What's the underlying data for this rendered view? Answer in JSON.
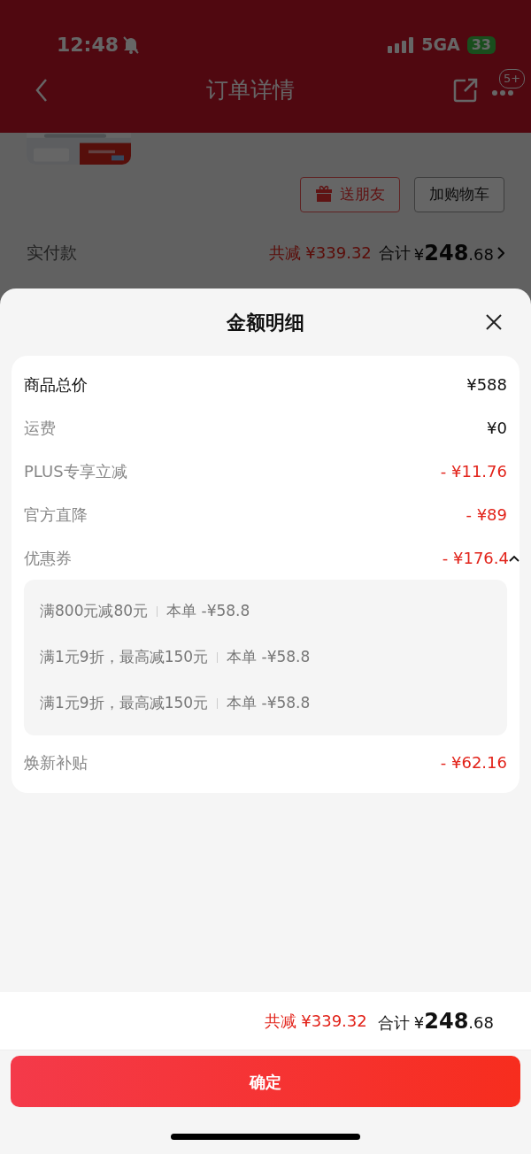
{
  "status_bar": {
    "time": "12:48",
    "network": "5GA",
    "battery": "33"
  },
  "background_page": {
    "title": "订单详情",
    "more_badge": "5+",
    "actions": [
      {
        "label": "送朋友",
        "kind": "gift"
      },
      {
        "label": "加购物车",
        "kind": "plain"
      }
    ],
    "paid": {
      "label": "实付款",
      "saved": "共减 ¥339.32",
      "total_label": "合计",
      "currency": "¥",
      "total_int": "248",
      "total_dec": ".68"
    }
  },
  "sheet": {
    "title": "金额明细",
    "rows": [
      {
        "label": "商品总价",
        "amount": "¥588",
        "kind": "total"
      },
      {
        "label": "运费",
        "amount": "¥0",
        "kind": "plain"
      },
      {
        "label": "PLUS专享立减",
        "amount": "- ¥11.76",
        "kind": "discount"
      },
      {
        "label": "官方直降",
        "amount": "- ¥89",
        "kind": "discount"
      },
      {
        "label": "优惠券",
        "amount": "- ¥176.4",
        "kind": "discount",
        "expanded": true,
        "children": [
          {
            "rule": "满800元减80元",
            "share": "本单 -¥58.8"
          },
          {
            "rule": "满1元9折，最高减150元",
            "share": "本单 -¥58.8"
          },
          {
            "rule": "满1元9折，最高减150元",
            "share": "本单 -¥58.8"
          }
        ]
      },
      {
        "label": "焕新补贴",
        "amount": "- ¥62.16",
        "kind": "discount"
      }
    ],
    "summary": {
      "saved": "共减 ¥339.32",
      "total_label": "合计",
      "currency": "¥",
      "total_int": "248",
      "total_dec": ".68"
    },
    "confirm": "确定"
  }
}
